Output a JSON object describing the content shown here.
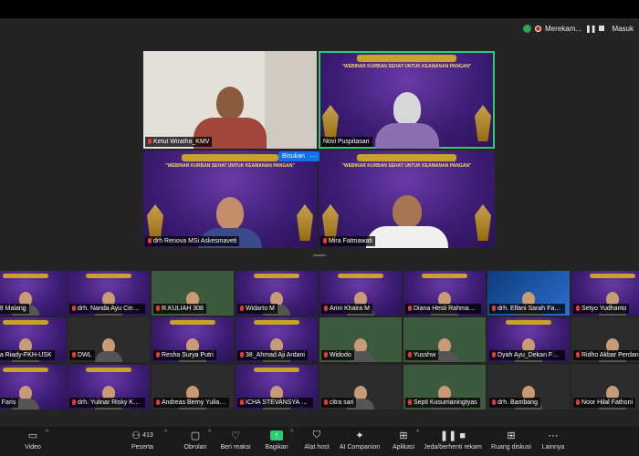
{
  "recording": {
    "label": "Merekam...",
    "masuk": "Masuk"
  },
  "big_tiles": [
    {
      "name": "Ketut Wiratha_KMV",
      "bg": "#d9d6d0",
      "type": "room"
    },
    {
      "name": "Novi Puspitasari",
      "bg": "purple",
      "type": "webinar"
    },
    {
      "name": "drh Renova MSi Askesmaveti",
      "bg": "purple",
      "type": "webinar"
    },
    {
      "name": "Mira Fatmawati",
      "bg": "purple",
      "type": "webinar"
    }
  ],
  "banner": {
    "title": "\"WEBINAR KURBAN SEHAT UNTUK KEAMANAN PANGAN\"",
    "heading": "WEBINAR KURBAN"
  },
  "bisukan_label": "Bisukan",
  "more_label": "···",
  "gallery": [
    {
      "name": "UB Malang"
    },
    {
      "name": "drh. Nanda Ayu Cindyas..."
    },
    {
      "name": "R.KULIAH 308"
    },
    {
      "name": "Widarto M"
    },
    {
      "name": "Arini Khaira M"
    },
    {
      "name": "Diana Hesti Rahmadani_..."
    },
    {
      "name": "drh. Elfani Sarah Faradin..."
    },
    {
      "name": "Setyo Yudhanto"
    },
    {
      "name": "nta Riady-FKH-USK"
    },
    {
      "name": "DWL"
    },
    {
      "name": "Resha Surya Putri"
    },
    {
      "name": "38_Ahmad Aji Ardani"
    },
    {
      "name": "Widodo"
    },
    {
      "name": "Yusshw"
    },
    {
      "name": "Dyah Ayu_Dekan FKH UB"
    },
    {
      "name": "Ridho Akbar Perdana"
    },
    {
      "name": "n. Faris"
    },
    {
      "name": "drh. Yulinar Risky Karam..."
    },
    {
      "name": "Andreas Berny Yulianto_..."
    },
    {
      "name": "ICHA STEVANSYA ROIT..."
    },
    {
      "name": "citra sari"
    },
    {
      "name": "Septi Kusumaningtyas"
    },
    {
      "name": "drh. Bambang"
    },
    {
      "name": "Noor Hilal Fathoni"
    }
  ],
  "toolbar": {
    "video": "Video",
    "participants": "Peserta",
    "participants_count": "413",
    "chat": "Obrolan",
    "react": "Beri reaksi",
    "share": "Bagikan",
    "host_tools": "Alat host",
    "companion": "AI Companion",
    "apps": "Aplikasi",
    "record": "Jeda/berhenti rekam",
    "breakout": "Ruang diskusi",
    "more": "Lainnya"
  }
}
